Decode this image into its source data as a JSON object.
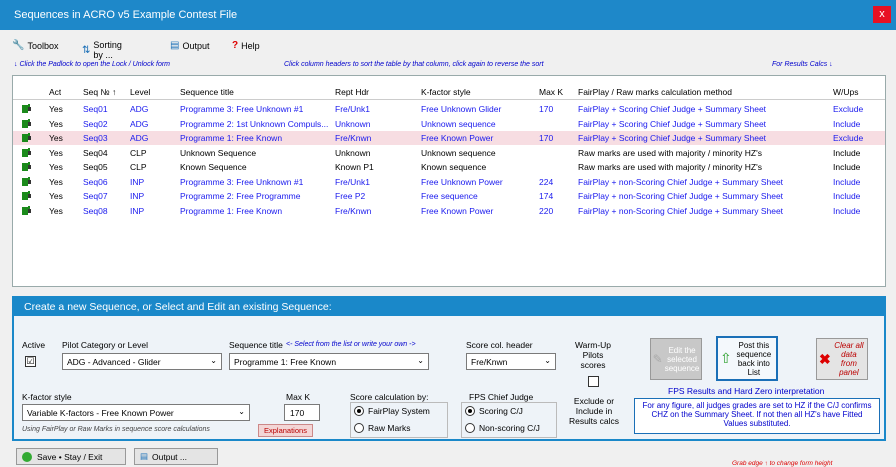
{
  "window": {
    "title": "Sequences in ACRO v5 Example Contest File",
    "close": "x"
  },
  "menu": [
    {
      "icon": "🔧",
      "icon_name": "wrench-icon",
      "label": "Toolbox"
    },
    {
      "icon": "⇅",
      "icon_name": "sort-icon",
      "label": "Sorting by ..."
    },
    {
      "icon": "▤",
      "icon_name": "output-icon",
      "label": "Output"
    },
    {
      "icon": "?",
      "icon_name": "help-icon",
      "label": "Help"
    }
  ],
  "hints": {
    "left": "↓ Click the Padlock to open the Lock / Unlock form",
    "center": "Click column headers to sort the table by that column, click again to reverse the sort",
    "right": "For Results Calcs ↓"
  },
  "table": {
    "headers": {
      "act": "Act",
      "seq": "Seq № ↑",
      "level": "Level",
      "title": "Sequence title",
      "rept": "Rept Hdr",
      "kstyle": "K-factor style",
      "maxk": "Max K",
      "method": "FairPlay / Raw marks calculation method",
      "wups": "W/Ups"
    },
    "rows": [
      {
        "act": "Yes",
        "seq": "Seq01",
        "level": "ADG",
        "title": "Programme 3: Free Unknown #1",
        "rept": "Fre/Unk1",
        "kstyle": "Free Unknown Glider",
        "maxk": "170",
        "method": "FairPlay + Scoring Chief Judge + Summary Sheet",
        "wups": "Exclude"
      },
      {
        "act": "Yes",
        "seq": "Seq02",
        "level": "ADG",
        "title": "Programme 2: 1st Unknown Compuls...",
        "rept": "Unknown",
        "kstyle": "Unknown sequence",
        "maxk": "",
        "method": "FairPlay + Scoring Chief Judge + Summary Sheet",
        "wups": "Include"
      },
      {
        "act": "Yes",
        "seq": "Seq03",
        "level": "ADG",
        "title": "Programme 1: Free Known",
        "rept": "Fre/Knwn",
        "kstyle": "Free Known Power",
        "maxk": "170",
        "method": "FairPlay + Scoring Chief Judge + Summary Sheet",
        "wups": "Exclude"
      },
      {
        "act": "Yes",
        "seq": "Seq04",
        "level": "CLP",
        "title": "Unknown Sequence",
        "rept": "Unknown",
        "kstyle": "Unknown sequence",
        "maxk": "",
        "method": "Raw marks are used with majority / minority HZ's",
        "wups": "Include"
      },
      {
        "act": "Yes",
        "seq": "Seq05",
        "level": "CLP",
        "title": "Known Sequence",
        "rept": "Known P1",
        "kstyle": "Known sequence",
        "maxk": "",
        "method": "Raw marks are used with majority / minority HZ's",
        "wups": "Include"
      },
      {
        "act": "Yes",
        "seq": "Seq06",
        "level": "INP",
        "title": "Programme 3: Free Unknown #1",
        "rept": "Fre/Unk1",
        "kstyle": "Free Unknown Power",
        "maxk": "224",
        "method": "FairPlay + non-Scoring Chief Judge + Summary Sheet",
        "wups": "Include"
      },
      {
        "act": "Yes",
        "seq": "Seq07",
        "level": "INP",
        "title": "Programme 2: Free Programme",
        "rept": "Free P2",
        "kstyle": "Free sequence",
        "maxk": "174",
        "method": "FairPlay + non-Scoring Chief Judge + Summary Sheet",
        "wups": "Include"
      },
      {
        "act": "Yes",
        "seq": "Seq08",
        "level": "INP",
        "title": "Programme 1: Free Known",
        "rept": "Fre/Knwn",
        "kstyle": "Free Known Power",
        "maxk": "220",
        "method": "FairPlay + non-Scoring Chief Judge + Summary Sheet",
        "wups": "Include"
      }
    ]
  },
  "panel": {
    "title": "Create a new Sequence, or Select and Edit an existing Sequence:",
    "active_label": "Active",
    "active_check": "☑",
    "pilot_label": "Pilot Category or Level",
    "pilot_value": "ADG - Advanced - Glider",
    "seqtitle_label": "Sequence title",
    "seqtitle_hint": "<- Select from the list or write your own ->",
    "seqtitle_value": "Programme 1: Free Known",
    "scorecol_label": "Score col. header",
    "scorecol_value": "Fre/Knwn",
    "warmup_label": "Warm-Up Pilots scores",
    "kstyle_label": "K-factor style",
    "kstyle_value": "Variable K-factors  -  Free Known Power",
    "maxk_label": "Max K",
    "maxk_value": "170",
    "scorecalc_label": "Score calculation by:",
    "fairplay": "FairPlay System",
    "rawmarks": "Raw Marks",
    "fpschief_label": "FPS Chief Judge",
    "scoring": "Scoring C/J",
    "nonscoring": "Non-scoring C/J",
    "exclude_label": "Exclude or Include in Results calcs",
    "using_hint": "Using FairPlay or Raw Marks in sequence score calculations",
    "explanations": "Explanations",
    "edit_btn": "Edit the selected sequence",
    "post_btn": "Post this sequence back into List",
    "clear_btn": "Clear all data from panel",
    "fps_title": "FPS Results and Hard Zero interpretation",
    "fps_text": "For any figure, all judges grades are set to HZ if the C/J confirms CHZ on the Summary Sheet. If not then all HZ's have Fitted Values substituted."
  },
  "bottom": {
    "save": "Save • Stay / Exit",
    "output": "Output ...",
    "right_hint": "Grab edge ↑ to change form height"
  }
}
